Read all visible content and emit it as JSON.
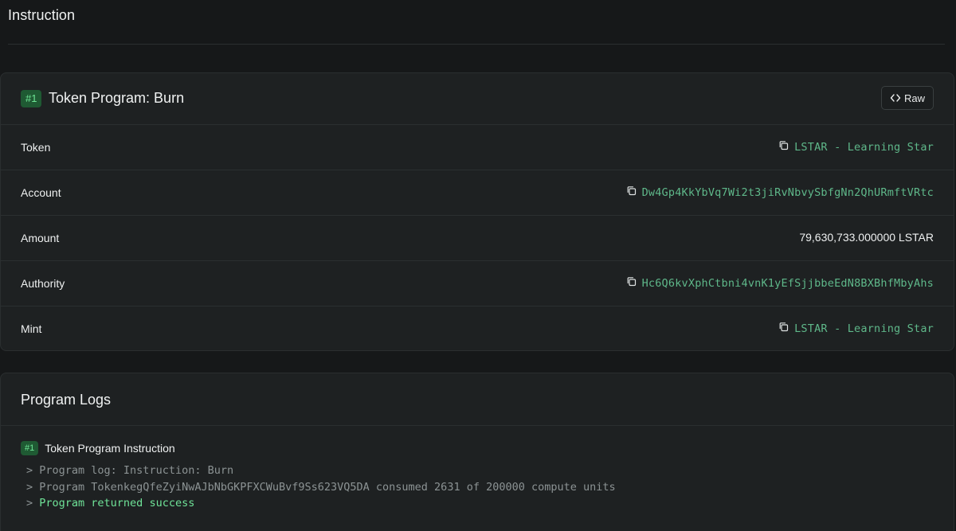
{
  "section": {
    "title": "Instruction"
  },
  "instruction": {
    "badge": "#1",
    "title": "Token Program: Burn",
    "raw_label": "Raw",
    "rows": [
      {
        "label": "Token",
        "value": "LSTAR - Learning Star",
        "type": "link",
        "copy": true
      },
      {
        "label": "Account",
        "value": "Dw4Gp4KkYbVq7Wi2t3jiRvNbvySbfgNn2QhURmftVRtc",
        "type": "link",
        "copy": true
      },
      {
        "label": "Amount",
        "value": "79,630,733.000000 LSTAR",
        "type": "plain",
        "copy": false
      },
      {
        "label": "Authority",
        "value": "Hc6Q6kvXphCtbni4vnK1yEfSjjbbeEdN8BXBhfMbyAhs",
        "type": "link",
        "copy": true
      },
      {
        "label": "Mint",
        "value": "LSTAR - Learning Star",
        "type": "link",
        "copy": true
      }
    ]
  },
  "logs": {
    "title": "Program Logs",
    "group_badge": "#1",
    "group_title": "Token Program Instruction",
    "lines": [
      {
        "prefix": ">",
        "text": "Program log: Instruction: Burn",
        "status": "normal"
      },
      {
        "prefix": ">",
        "text": "Program TokenkegQfeZyiNwAJbNbGKPFXCWuBvf9Ss623VQ5DA consumed 2631 of 200000 compute units",
        "status": "normal"
      },
      {
        "prefix": ">",
        "text": "Program returned success",
        "status": "success"
      }
    ]
  },
  "colors": {
    "background": "#161819",
    "card": "#1e2122",
    "link": "#5fb88a",
    "badge_bg": "#1f5a33",
    "badge_fg": "#6ee696",
    "success": "#6fe398",
    "muted": "#8c9394"
  },
  "icons": {
    "raw": "code-brackets-icon",
    "copy": "copy-icon"
  }
}
